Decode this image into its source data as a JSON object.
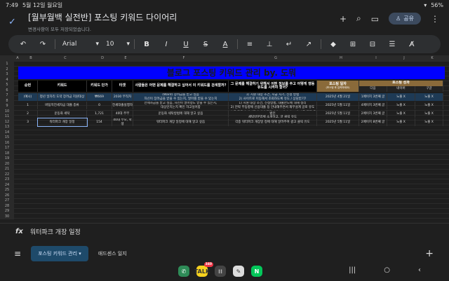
{
  "status": {
    "time": "7:49",
    "date": "5월 12일 월요일",
    "battery": "56%"
  },
  "doc": {
    "title": "[월부월백 실전반] 포스팅 키워드 다이어리",
    "save_status": "변경사항이 모두 저장되었습니다.",
    "share_label": "공유"
  },
  "toolbar": {
    "font": "Arial",
    "size": "10"
  },
  "columns": [
    "A",
    "B",
    "C",
    "D",
    "E",
    "F",
    "G",
    "H",
    "I",
    "J",
    "K"
  ],
  "rows": [
    "1",
    "2",
    "3",
    "4",
    "5",
    "6",
    "7",
    "8",
    "9",
    "10",
    "11",
    "12",
    "13",
    "14",
    "15",
    "16",
    "17",
    "18",
    "19",
    "20",
    "21",
    "22",
    "23",
    "24",
    "25",
    "26",
    "27",
    "28",
    "29",
    "30"
  ],
  "sheet": {
    "banner": "블로그 포스팅 키워드 관리 by. 도뭐",
    "headers": {
      "num": "순번",
      "keyword": "키워드",
      "price": "키워드 단가",
      "target": "타겟",
      "q1": "사람들은 어떤 문제를 해결하고 싶어서 이 키워드를 검색할까?",
      "q2": "그 문제를 해결하기 위해서 어떤 정보를 주고 어떻게 행동 유도를 시켜야 할까?",
      "date": "포스팅 일자",
      "date_note": "(포스팅 후 입력하세요)",
      "perf": "포스팅 성과",
      "p1": "다음",
      "p2": "네이버",
      "p3": "구글"
    },
    "rows": [
      {
        "num": "(예시)",
        "keyword": "청년 일자리 도약 장려금 지원대상",
        "price": "₩669",
        "target": "2030 무직자",
        "q1": "(Want) 장려금을 받고 싶음\n자신이 장려금을 받을 수 있는지, 얼마를 받을 수 있는지",
        "q2": "1) 지원 대상 조건, 지급 시기, 신청 방법\n2) 사이트로 이동해서 조회하도록 유도 / 상담받기?",
        "date": "2025년 4월 21일",
        "p1": "1페이지 3번째 글",
        "p2": "노출 X",
        "p3": "노출 X"
      },
      {
        "num": "1",
        "keyword": "버팀목전세자금 대출 종류",
        "price": "0",
        "target": "전세대출실행자",
        "q1": "전세자금을 받고 싶음, 자신이 얼마정도 받을 수 있는지,\n대상인지는지 확인 하고싶어함",
        "q2": "1) 지원 대상 조건, 신청방법, 대출한도에 대해 정리\n2) 안박 부동향에 신용대출 등 안내해주면서 재무설계 글로 유도",
        "date": "2025년 5월 11일",
        "p1": "4페이지 3번째 글",
        "p2": "노출 X",
        "p3": "노출 X"
      },
      {
        "num": "2",
        "keyword": "운동화 세탁",
        "price": "1,721",
        "target": "40대 주부",
        "q1": "운동화 세탁방법에 대해 알고 싶음",
        "q2": "1) 종 운동화 세탁법에 대해 간단하게 소개하고, 요새 가장 편한 방법인\n세탁방문업체 소개하고, 글 클릭 유도",
        "date": "2025년 5월 11일",
        "p1": "2페이지 3번째 글",
        "p2": "노출 X",
        "p3": "노출 X"
      },
      {
        "num": "3",
        "keyword": "워터파크 개장 일정",
        "price": "154",
        "target": "40대 부모, 학생",
        "q1": "워터파크 개장 일정에 대해 알고 싶음",
        "q2": "각종 워터파크 개장일 정에 대해 알려주며 광고 클릭 유도",
        "date": "2025년 5월 11일",
        "p1": "2페이지 8번째 글",
        "p2": "노출 X",
        "p3": "노출 X"
      }
    ]
  },
  "formula": {
    "value": "워터파크 개장 일정"
  },
  "tabs": [
    {
      "label": "포스팅 키워드 관리"
    },
    {
      "label": "애드센스 일지"
    }
  ],
  "dock": {
    "badge": "340"
  }
}
